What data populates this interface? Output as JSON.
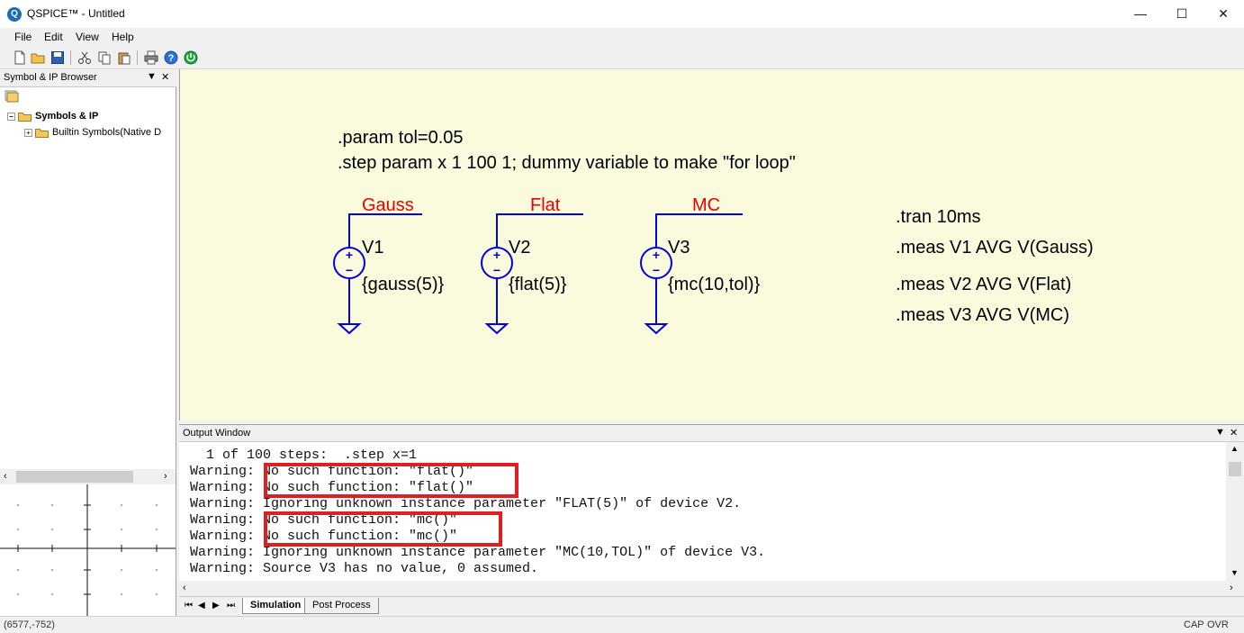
{
  "window": {
    "title": "QSPICE™ - Untitled",
    "icon_letter": "Q",
    "minimize": "—",
    "maximize": "☐",
    "close": "✕"
  },
  "menu": [
    "File",
    "Edit",
    "View",
    "Help"
  ],
  "toolbar": {
    "icons": [
      "new-file-icon",
      "open-folder-icon",
      "save-icon",
      "cut-icon",
      "copy-icon",
      "paste-icon",
      "print-icon",
      "help-icon",
      "run-icon"
    ]
  },
  "browser": {
    "title": "Symbol & IP Browser",
    "tree": [
      {
        "label": "Symbols & IP",
        "expander": "−",
        "bold": true
      },
      {
        "label": "Builtin Symbols(Native D",
        "expander": "+",
        "bold": false
      }
    ]
  },
  "schematic": {
    "directives": [
      ".param tol=0.05",
      ".step param x 1 100 1;  dummy variable to make \"for loop\""
    ],
    "sources": [
      {
        "net": "Gauss",
        "name": "V1",
        "value": "{gauss(5)}"
      },
      {
        "net": "Flat",
        "name": "V2",
        "value": "{flat(5)}"
      },
      {
        "net": "MC",
        "name": "V3",
        "value": "{mc(10,tol)}"
      }
    ],
    "commands": [
      ".tran 10ms",
      ".meas V1 AVG V(Gauss)",
      ".meas V2 AVG V(Flat)",
      ".meas V3 AVG V(MC)"
    ],
    "colors": {
      "wire": "#0000e0",
      "net_label": "#ee0000",
      "text": "#000000",
      "background": "#fafadc"
    }
  },
  "output": {
    "title": "Output Window",
    "lines": [
      "  1 of 100 steps:  .step x=1",
      "Warning: No such function: \"flat()\"",
      "Warning: No such function: \"flat()\"",
      "Warning: Ignoring unknown instance parameter \"FLAT(5)\" of device V2.",
      "Warning: No such function: \"mc()\"",
      "Warning: No such function: \"mc()\"",
      "Warning: Ignoring unknown instance parameter \"MC(10,TOL)\" of device V3.",
      "Warning: Source V3 has no value, 0 assumed."
    ],
    "highlight_color": "#e02020"
  },
  "tabs": {
    "nav": [
      "⏮",
      "◀",
      "▶",
      "⏭"
    ],
    "items": [
      "Simulation",
      "Post Process"
    ],
    "active": "Simulation"
  },
  "status": {
    "coords": "(6577,-752)",
    "cap": "CAP",
    "ovr": "OVR"
  }
}
